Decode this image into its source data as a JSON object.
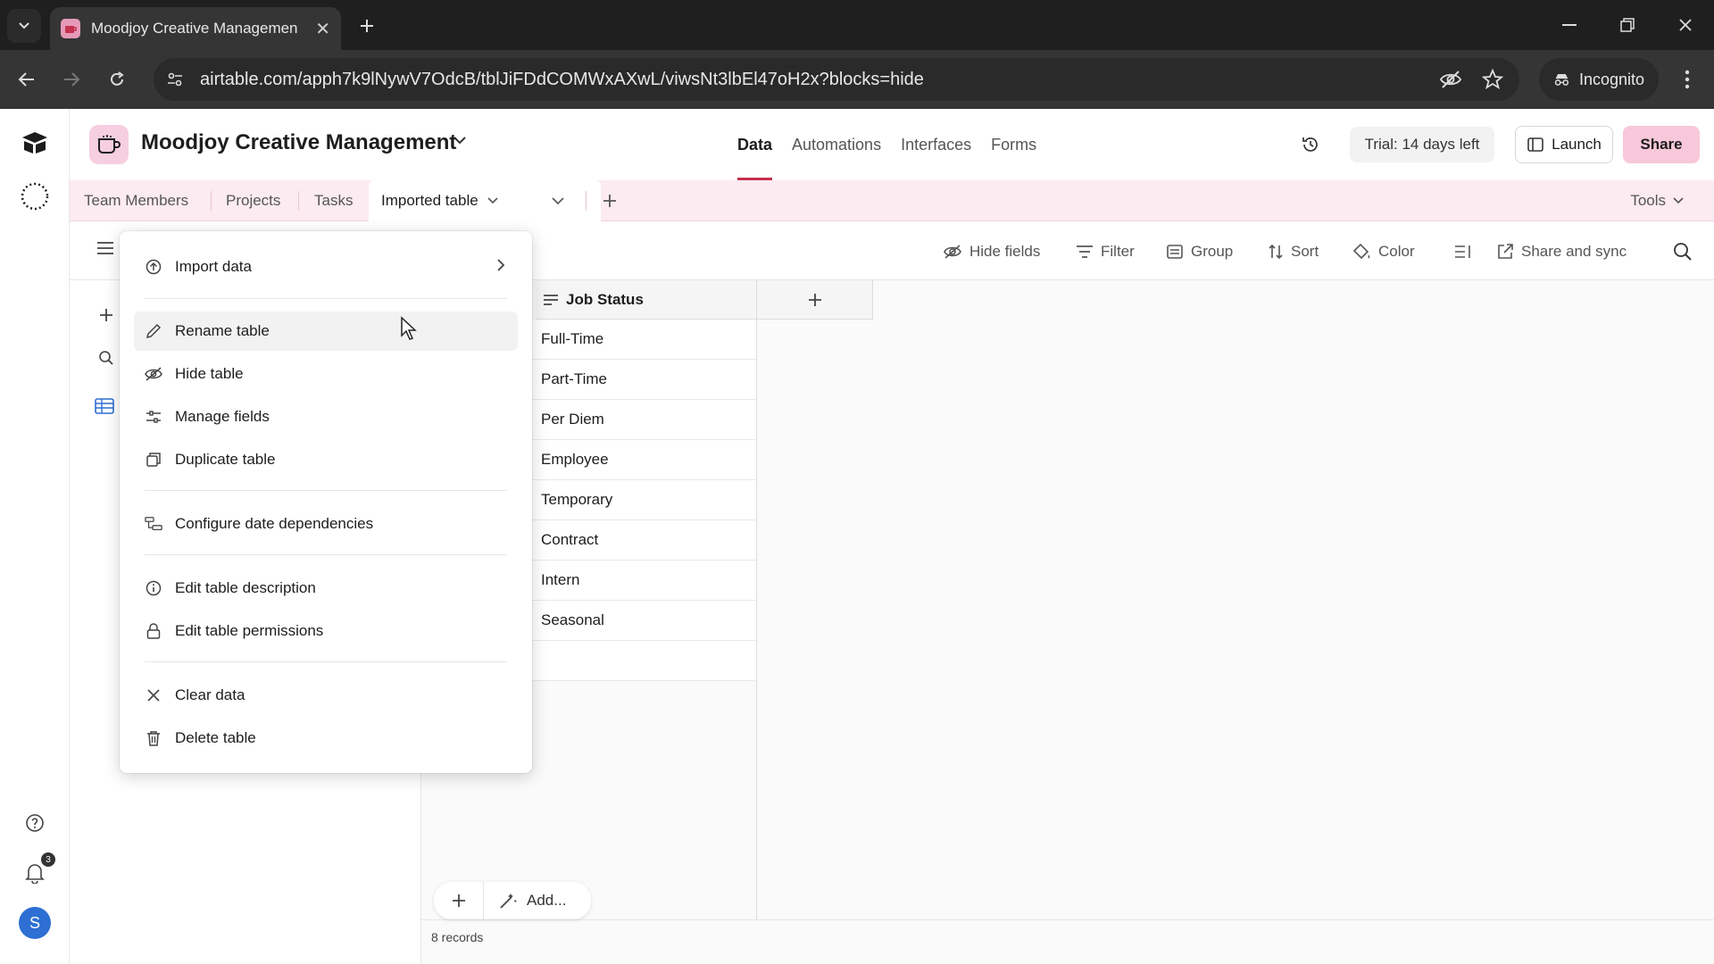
{
  "browser": {
    "tab_title": "Moodjoy Creative Managemen",
    "url": "airtable.com/apph7k9lNywV7OdcB/tblJiFDdCOMWxAXwL/viwsNt3lbEl47oH2x?blocks=hide",
    "incognito_label": "Incognito"
  },
  "app": {
    "base_name": "Moodjoy Creative Management",
    "nav_tabs": [
      "Data",
      "Automations",
      "Interfaces",
      "Forms"
    ],
    "active_nav": "Data",
    "trial_label": "Trial: 14 days left",
    "launch_label": "Launch",
    "share_label": "Share"
  },
  "tables": {
    "tabs": [
      "Team Members",
      "Projects",
      "Tasks",
      "Imported table"
    ],
    "active": "Imported table",
    "tools_label": "Tools"
  },
  "toolbar": {
    "hide_fields": "Hide fields",
    "filter": "Filter",
    "group": "Group",
    "sort": "Sort",
    "color": "Color",
    "share_sync": "Share and sync"
  },
  "grid": {
    "column_header": "Job Status",
    "rows": [
      "Full-Time",
      "Part-Time",
      "Per Diem",
      "Employee",
      "Temporary",
      "Contract",
      "Intern",
      "Seasonal"
    ],
    "add_label": "Add...",
    "records_label": "8 records"
  },
  "menu": {
    "items": [
      {
        "label": "Import data",
        "icon": "import-icon"
      },
      {
        "label": "Rename table",
        "icon": "pencil-icon"
      },
      {
        "label": "Hide table",
        "icon": "eye-slash-icon"
      },
      {
        "label": "Manage fields",
        "icon": "sliders-icon"
      },
      {
        "label": "Duplicate table",
        "icon": "duplicate-icon"
      },
      {
        "label": "Configure date dependencies",
        "icon": "date-dependencies-icon"
      },
      {
        "label": "Edit table description",
        "icon": "info-icon"
      },
      {
        "label": "Edit table permissions",
        "icon": "lock-icon"
      },
      {
        "label": "Clear data",
        "icon": "x-icon"
      },
      {
        "label": "Delete table",
        "icon": "trash-icon"
      }
    ]
  },
  "rail": {
    "notification_count": "3",
    "avatar_initial": "S"
  },
  "colors": {
    "accent": "#c6314e",
    "tablebar_bg": "#fcebf1",
    "share_bg": "#f7c8d9",
    "avatar": "#2d6fd2"
  }
}
